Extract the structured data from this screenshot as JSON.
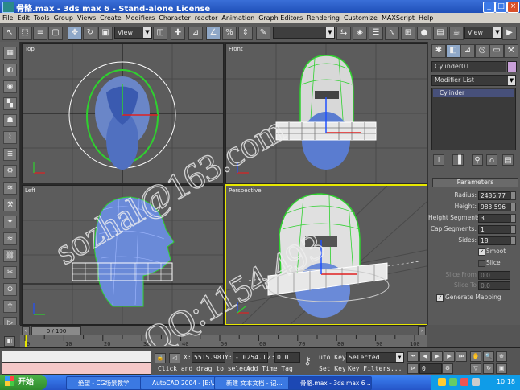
{
  "window": {
    "title": "骨骼.max - 3ds max 6 - Stand-alone License",
    "minimize": "_",
    "maximize": "□",
    "close": "×"
  },
  "menu": [
    "File",
    "Edit",
    "Tools",
    "Group",
    "Views",
    "Create",
    "Modifiers",
    "Character",
    "reactor",
    "Animation",
    "Graph Editors",
    "Rendering",
    "Customize",
    "MAXScript",
    "Help"
  ],
  "toolbar": {
    "view_dropdown": "View",
    "view_dropdown_2": "View"
  },
  "viewports": {
    "top": "Top",
    "front": "Front",
    "left": "Left",
    "perspective": "Perspective"
  },
  "command_panel": {
    "object_name": "Cylinder01",
    "object_color": "#c8a0d8",
    "modifier_list": "Modifier List",
    "stack_item": "Cylinder",
    "rollout_title": "Parameters",
    "params": [
      {
        "label": "Radius:",
        "value": "2486.77"
      },
      {
        "label": "Height:",
        "value": "983.596"
      },
      {
        "label": "Height Segments:",
        "value": "3"
      },
      {
        "label": "Cap Segments:",
        "value": "1"
      },
      {
        "label": "Sides:",
        "value": "18"
      }
    ],
    "smooth_label": "Smoot",
    "slice_label": "Slice",
    "slice_from_label": "Slice From",
    "slice_from_value": "0.0",
    "slice_to_label": "Slice To",
    "slice_to_value": "0.0",
    "gen_mapping_label": "Generate Mapping"
  },
  "timeline": {
    "frame_counter": "0 / 100",
    "ruler_ticks": [
      "0",
      "10",
      "20",
      "30",
      "40",
      "50",
      "60",
      "70",
      "80",
      "90",
      "100"
    ]
  },
  "status": {
    "x_label": "X:",
    "x_value": "5515.981",
    "y_label": "Y:",
    "y_value": "-10254.1",
    "z_label": "Z:",
    "z_value": "0.0",
    "prompt": "Click and drag to select",
    "add_time_tag": "Add Time Tag",
    "auto_key": "uto Key",
    "set_key": "Set Key",
    "selected": "Selected",
    "key_filters": "Key Filters...",
    "frame_value": "0"
  },
  "watermark": {
    "line1": "sozhal@163.com",
    "line2": "QQ:1154 493"
  },
  "taskbar": {
    "start": "开始",
    "tasks": [
      "绝望 - CG场景教学",
      "AutoCAD 2004 - [E:\\...",
      "新建 文本文档 - 记...",
      "骨骼.max - 3ds max 6 ..."
    ],
    "clock": "10:18"
  }
}
